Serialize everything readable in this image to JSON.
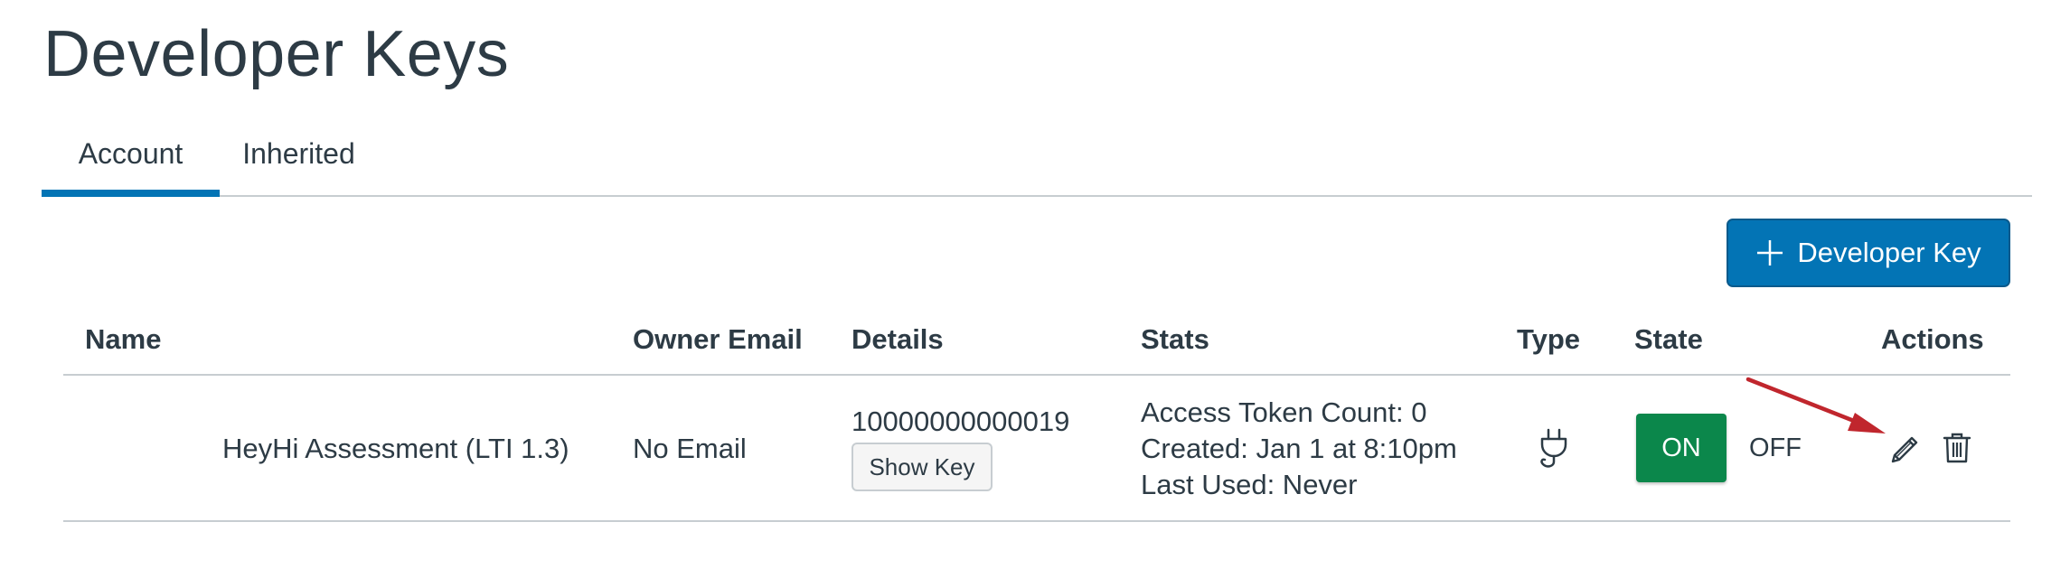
{
  "page": {
    "title": "Developer Keys"
  },
  "tabs": [
    {
      "label": "Account",
      "active": true
    },
    {
      "label": "Inherited",
      "active": false
    }
  ],
  "add_button": {
    "label": "Developer Key",
    "icon": "plus-icon"
  },
  "table": {
    "columns": [
      "Name",
      "Owner Email",
      "Details",
      "Stats",
      "Type",
      "State",
      "Actions"
    ],
    "rows": [
      {
        "name": "HeyHi Assessment (LTI 1.3)",
        "owner_email": "No Email",
        "details_id": "10000000000019",
        "show_key_label": "Show Key",
        "stats": {
          "access_token_count": "Access Token Count: 0",
          "created": "Created: Jan 1 at 8:10pm",
          "last_used": "Last Used: Never"
        },
        "type_icon": "plug-icon",
        "state_on_label": "ON",
        "state_off_label": "OFF",
        "state": "ON",
        "actions": [
          "pencil-icon",
          "trash-icon"
        ]
      }
    ]
  },
  "colors": {
    "brand_blue": "#0374b5",
    "on_green": "#0b874b",
    "text": "#2d3b45",
    "divider": "#c7cdd1",
    "annotation_red": "#c0262d"
  }
}
